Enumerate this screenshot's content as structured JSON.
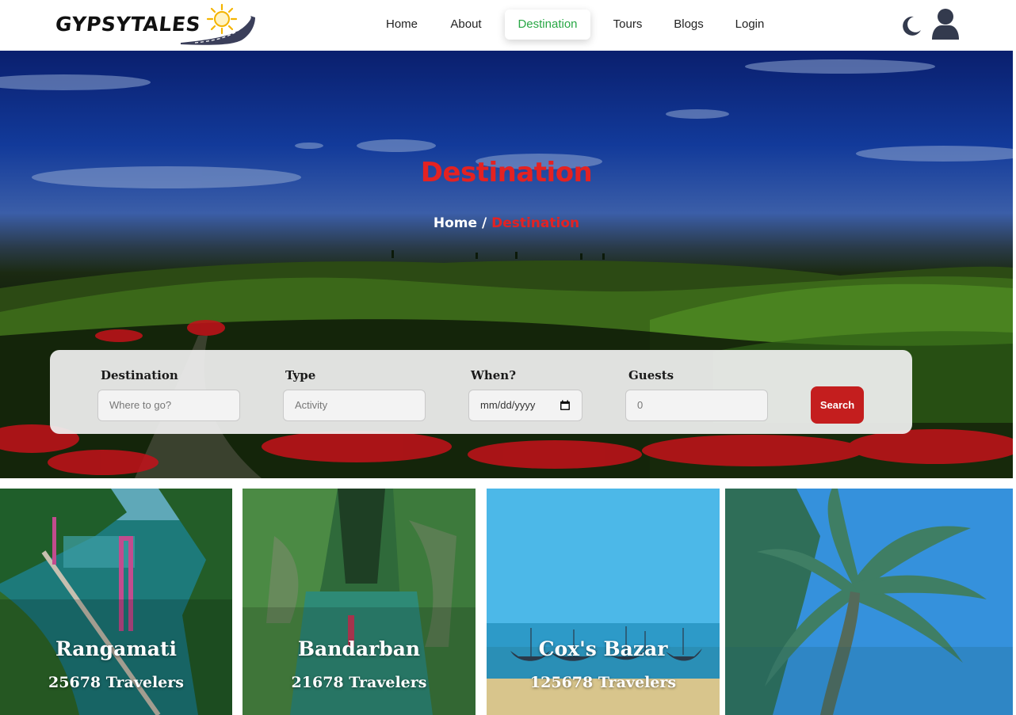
{
  "brand": {
    "name": "GYPSYTALES"
  },
  "nav": {
    "items": [
      {
        "label": "Home",
        "active": false
      },
      {
        "label": "About",
        "active": false
      },
      {
        "label": "Destination",
        "active": true
      },
      {
        "label": "Tours",
        "active": false
      },
      {
        "label": "Blogs",
        "active": false
      },
      {
        "label": "Login",
        "active": false
      }
    ],
    "icons": [
      "moon-icon",
      "user-icon"
    ]
  },
  "hero": {
    "title": "Destination",
    "breadcrumb": {
      "home": "Home",
      "separator": "/",
      "current": "Destination"
    }
  },
  "search": {
    "fields": [
      {
        "label": "Destination",
        "placeholder": "Where to go?"
      },
      {
        "label": "Type",
        "placeholder": "Activity"
      },
      {
        "label": "When?",
        "placeholder": "mm/dd/yyyy"
      },
      {
        "label": "Guests",
        "placeholder": "0"
      }
    ],
    "button_label": "Search"
  },
  "destinations": [
    {
      "name": "Rangamati",
      "travelers": "25678 Travelers"
    },
    {
      "name": "Bandarban",
      "travelers": "21678 Travelers"
    },
    {
      "name": "Cox's Bazar",
      "travelers": "125678 Travelers"
    },
    {
      "name": "",
      "travelers": ""
    }
  ],
  "colors": {
    "accent_red": "#e42222",
    "active_nav_green": "#28a745",
    "search_button": "#c41e1e"
  }
}
